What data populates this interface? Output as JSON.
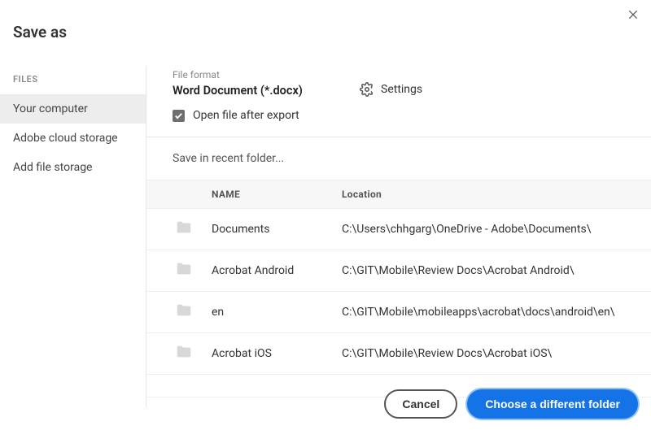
{
  "dialog": {
    "title": "Save as"
  },
  "sidebar": {
    "heading": "FILES",
    "items": [
      {
        "label": "Your computer",
        "selected": true
      },
      {
        "label": "Adobe cloud storage",
        "selected": false
      },
      {
        "label": "Add file storage",
        "selected": false
      }
    ]
  },
  "format": {
    "label": "File format",
    "value": "Word Document (*.docx)",
    "settings_label": "Settings",
    "open_after_label": "Open file after export",
    "open_after_checked": true
  },
  "recent": {
    "label": "Save in recent folder...",
    "columns": {
      "name": "NAME",
      "location": "Location"
    },
    "rows": [
      {
        "name": "Documents",
        "location": "C:\\Users\\chhgarg\\OneDrive - Adobe\\Documents\\"
      },
      {
        "name": "Acrobat Android",
        "location": "C:\\GIT\\Mobile\\Review Docs\\Acrobat Android\\"
      },
      {
        "name": "en",
        "location": "C:\\GIT\\Mobile\\mobileapps\\acrobat\\docs\\android\\en\\"
      },
      {
        "name": "Acrobat iOS",
        "location": "C:\\GIT\\Mobile\\Review Docs\\Acrobat iOS\\"
      }
    ]
  },
  "footer": {
    "cancel": "Cancel",
    "choose": "Choose a different folder"
  }
}
